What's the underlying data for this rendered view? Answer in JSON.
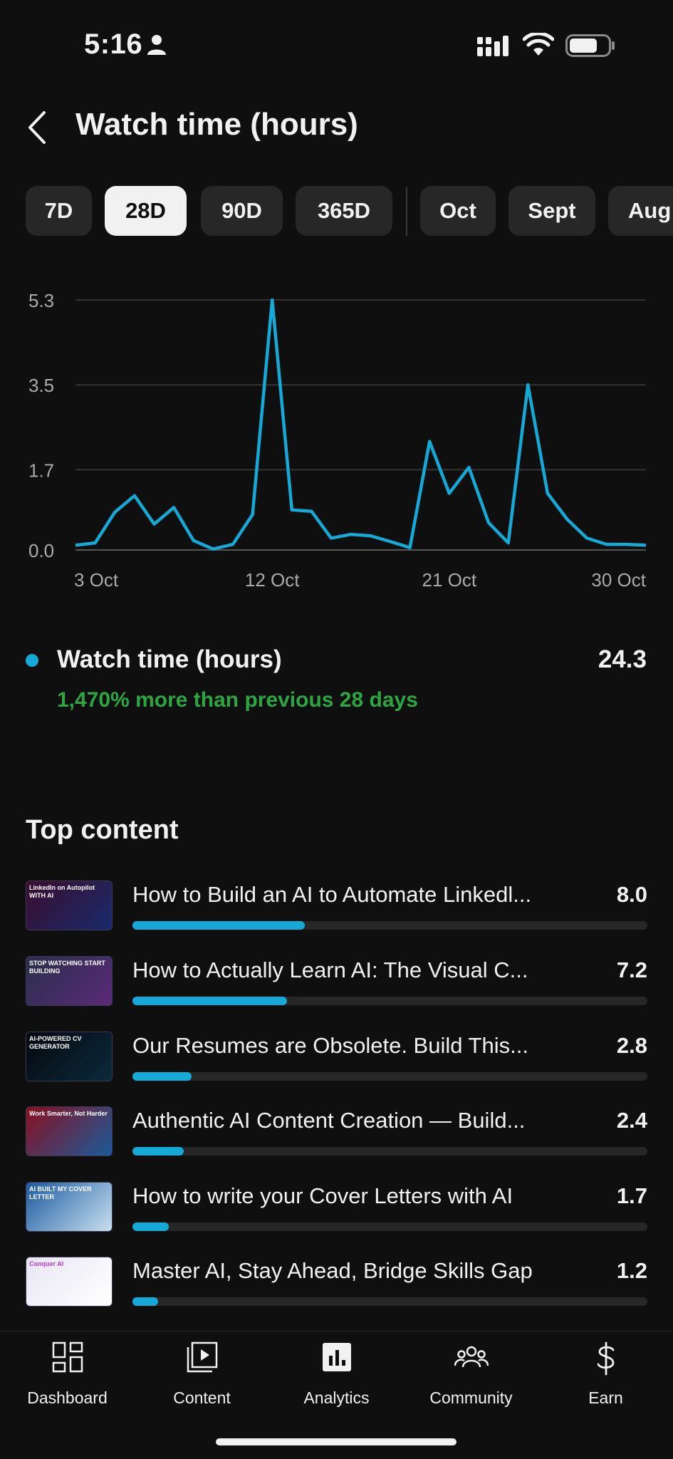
{
  "status_bar": {
    "time": "5:16"
  },
  "header": {
    "title": "Watch time (hours)"
  },
  "ranges": [
    "7D",
    "28D",
    "90D",
    "365D"
  ],
  "months": [
    "Oct",
    "Sept",
    "Aug"
  ],
  "active_range": "28D",
  "chart_data": {
    "type": "line",
    "title": "",
    "xlabel": "",
    "ylabel": "",
    "y_ticks": [
      "5.3",
      "3.5",
      "1.7",
      "0.0"
    ],
    "x_tick_labels": [
      "3 Oct",
      "12 Oct",
      "21 Oct",
      "30 Oct"
    ],
    "ylim": [
      0,
      5.3
    ],
    "grid": true,
    "series": [
      {
        "color": "#14a9d6",
        "x": [
          "2 Oct",
          "3 Oct",
          "4 Oct",
          "5 Oct",
          "6 Oct",
          "7 Oct",
          "8 Oct",
          "9 Oct",
          "10 Oct",
          "11 Oct",
          "12 Oct",
          "13 Oct",
          "14 Oct",
          "15 Oct",
          "16 Oct",
          "17 Oct",
          "18 Oct",
          "19 Oct",
          "20 Oct",
          "21 Oct",
          "22 Oct",
          "23 Oct",
          "24 Oct",
          "25 Oct",
          "26 Oct",
          "27 Oct",
          "28 Oct",
          "29 Oct",
          "30 Oct",
          "31 Oct"
        ],
        "values": [
          0.1,
          0.15,
          0.8,
          1.15,
          0.55,
          0.9,
          0.2,
          0.02,
          0.12,
          0.75,
          5.3,
          0.85,
          0.82,
          0.25,
          0.33,
          0.3,
          0.18,
          0.05,
          2.3,
          1.2,
          1.75,
          0.58,
          0.15,
          3.5,
          1.2,
          0.65,
          0.25,
          0.12,
          0.12,
          0.1
        ]
      }
    ]
  },
  "summary": {
    "label": "Watch time (hours)",
    "value": "24.3",
    "delta": "1,470% more than previous 28 days",
    "dot_color": "#14a9d6"
  },
  "top_content": {
    "title": "Top content",
    "max_value": 24.3,
    "items": [
      {
        "title": "How to Build an AI to Automate Linkedl...",
        "value": "8.0",
        "fraction": 0.335,
        "thumb": [
          "#3a0d2e",
          "#1a2a6b"
        ],
        "thumb_text": "LinkedIn on Autopilot WITH AI"
      },
      {
        "title": "How to Actually Learn AI: The Visual C...",
        "value": "7.2",
        "fraction": 0.3,
        "thumb": [
          "#2a2f4a",
          "#5a2a7a"
        ],
        "thumb_text": "STOP WATCHING START BUILDING"
      },
      {
        "title": "Our Resumes are Obsolete. Build This...",
        "value": "2.8",
        "fraction": 0.115,
        "thumb": [
          "#05080f",
          "#0b2a3a"
        ],
        "thumb_text": "AI-POWERED CV GENERATOR"
      },
      {
        "title": "Authentic AI Content Creation — Build...",
        "value": "2.4",
        "fraction": 0.1,
        "thumb": [
          "#8a1020",
          "#1a5a9a"
        ],
        "thumb_text": "Work Smarter, Not Harder"
      },
      {
        "title": "How to write your Cover Letters with AI",
        "value": "1.7",
        "fraction": 0.07,
        "thumb": [
          "#1c5aa0",
          "#c8e0f0"
        ],
        "thumb_text": "AI BUILT MY COVER LETTER"
      },
      {
        "title": "Master AI, Stay Ahead, Bridge Skills Gap",
        "value": "1.2",
        "fraction": 0.05,
        "thumb": [
          "#e9e6f2",
          "#ffffff"
        ],
        "thumb_text": "Conquer AI"
      }
    ]
  },
  "nav": [
    {
      "label": "Dashboard",
      "icon": "dashboard-icon"
    },
    {
      "label": "Content",
      "icon": "content-icon"
    },
    {
      "label": "Analytics",
      "icon": "analytics-icon"
    },
    {
      "label": "Community",
      "icon": "community-icon"
    },
    {
      "label": "Earn",
      "icon": "earn-icon"
    }
  ]
}
